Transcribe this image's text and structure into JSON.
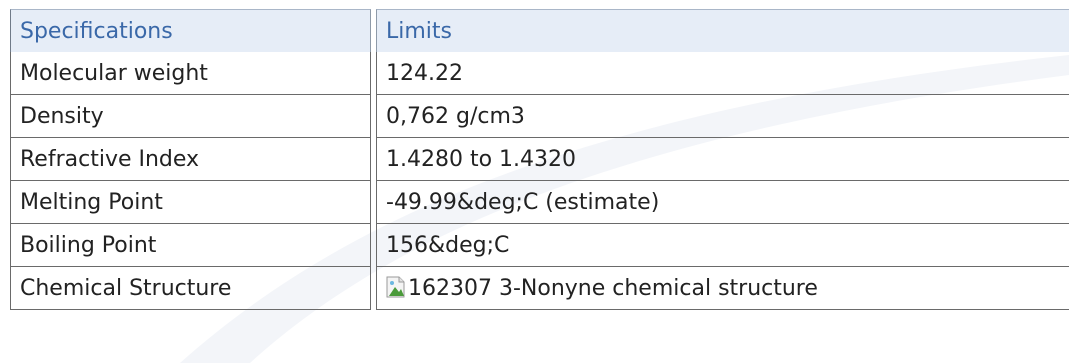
{
  "table": {
    "headers": [
      "Specifications",
      "Limits"
    ],
    "rows": [
      {
        "label": "Molecular weight",
        "value": "124.22"
      },
      {
        "label": "Density",
        "value": "0,762 g/cm3"
      },
      {
        "label": "Refractive Index",
        "value": "1.4280 to 1.4320"
      },
      {
        "label": "Melting Point",
        "value": "-49.99&deg;C (estimate)"
      },
      {
        "label": "Boiling Point",
        "value": "156&deg;C"
      },
      {
        "label": "Chemical Structure",
        "value": "162307 3-Nonyne chemical structure"
      }
    ]
  },
  "icons": {
    "broken_image": "broken-image-icon"
  },
  "colors": {
    "header_text": "#3a68a8",
    "header_bg": "#e6edf7",
    "cell_text": "#222222"
  }
}
